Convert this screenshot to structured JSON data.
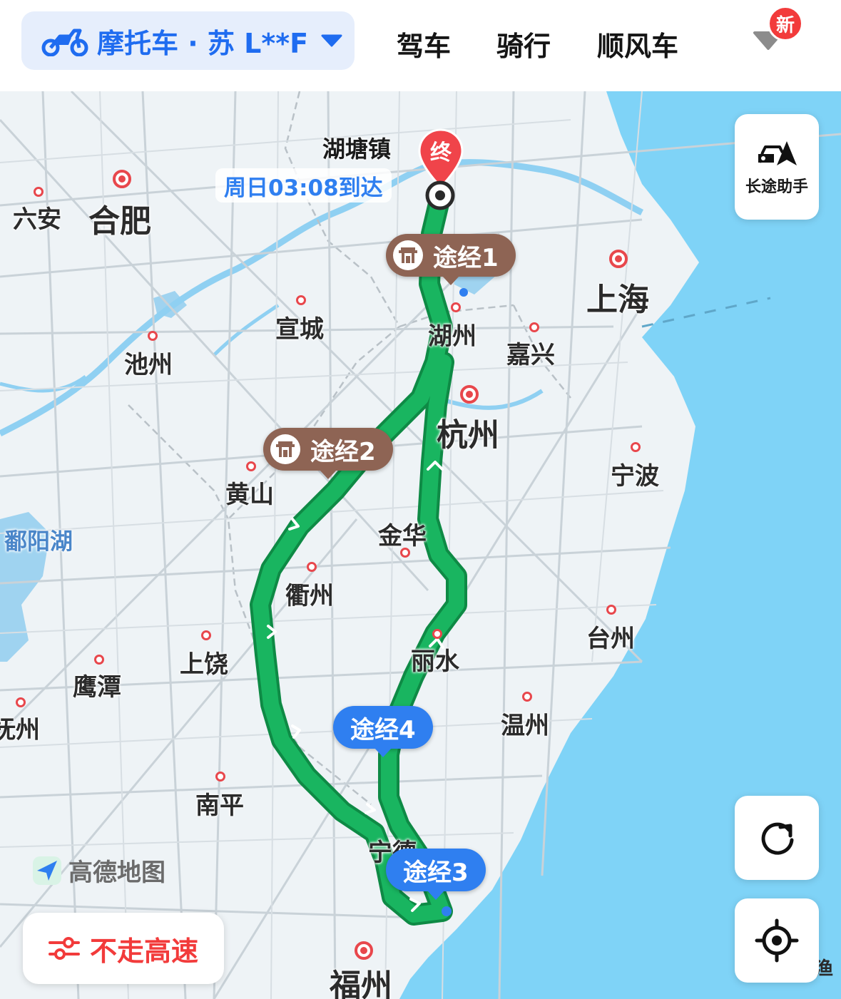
{
  "header": {
    "vehicle_label": "摩托车 · 苏 L**F",
    "tabs": [
      {
        "label": "驾车"
      },
      {
        "label": "骑行"
      },
      {
        "label": "顺风车"
      }
    ],
    "badge": "新"
  },
  "map": {
    "destination": {
      "marker": "终",
      "name": "湖塘镇",
      "eta": "周日03:08到达"
    },
    "waypoints": [
      {
        "label": "途经1",
        "style": "brown"
      },
      {
        "label": "途经2",
        "style": "brown"
      },
      {
        "label": "途经3",
        "style": "blue"
      },
      {
        "label": "途经4",
        "style": "blue"
      }
    ],
    "cities": {
      "hefei": "合肥",
      "luan": "六安",
      "shanghai": "上海",
      "xuancheng": "宣城",
      "huzhou": "湖州",
      "jiaxing": "嘉兴",
      "chizhou": "池州",
      "hangzhou": "杭州",
      "ningbo": "宁波",
      "huangshan": "黄山",
      "poyang": "鄱阳湖",
      "jinhua": "金华",
      "quzhou": "衢州",
      "taizhou": "台州",
      "lishui": "丽水",
      "shangrao": "上饶",
      "yingtan": "鹰潭",
      "wenzhou": "温州",
      "fuzhou_jx": "抚州",
      "nanping": "南平",
      "ningde": "宁德",
      "fuzhou": "福州",
      "edge": "渔"
    },
    "watermark": "高德地图",
    "long_trip_label": "长途助手",
    "avoid_highway_label": "不走高速",
    "colors": {
      "route": "#19b560",
      "route_border": "#0e8a45",
      "sea": "#7fd3f7",
      "accent": "#2f7ff0",
      "waypoint_brown": "#8e6454",
      "red": "#f23b3b"
    },
    "icons": [
      "motorcycle-icon",
      "caret-down-icon",
      "more-icon",
      "car-route-icon",
      "refresh-icon",
      "locate-icon",
      "settings-sliders-icon",
      "gaode-logo-icon"
    ]
  }
}
